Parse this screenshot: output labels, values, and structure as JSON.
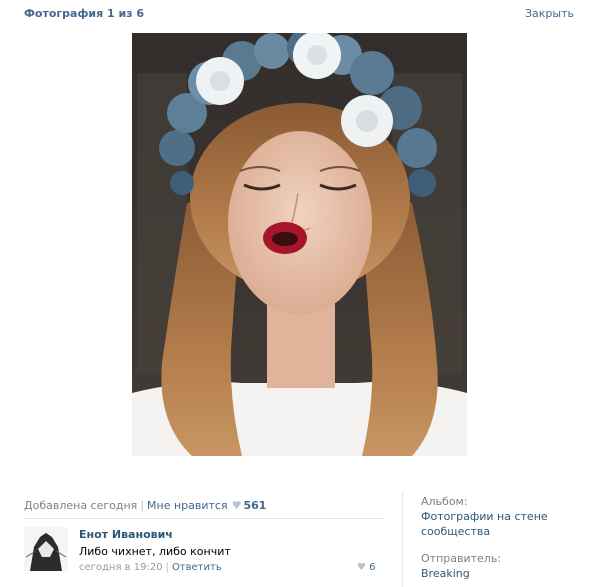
{
  "header": {
    "title": "Фотография 1 из 6",
    "close_label": "Закрыть"
  },
  "photo": {
    "description": "portrait-photo"
  },
  "meta": {
    "added": "Добавлена сегодня",
    "separator": "|",
    "like_label": "Мне нравится",
    "like_count": "561"
  },
  "comment": {
    "author": "Енот Иванович",
    "text": "Либо чихнет, либо кончит",
    "time": "сегодня в 19:20",
    "separator": "|",
    "reply_label": "Ответить",
    "likes": "6"
  },
  "side": {
    "album_label": "Альбом:",
    "album_name": "Фотографии на стене сообщества",
    "sender_label": "Отправитель:",
    "sender_name": "Breaking"
  },
  "colors": {
    "link": "#45688e",
    "author": "#2b587a",
    "muted": "#808080"
  }
}
